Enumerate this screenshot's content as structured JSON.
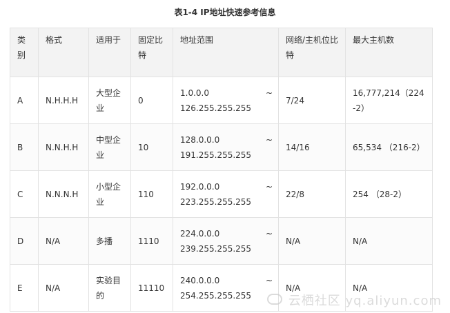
{
  "title": "表1-4 IP地址快速参考信息",
  "table": {
    "headers": [
      "类别",
      "格式",
      "适用于",
      "固定比特",
      "地址范围",
      "网络/主机位比特",
      "最大主机数"
    ],
    "rows": [
      {
        "class": "A",
        "format": "N.H.H.H",
        "use": "大型企业",
        "fixed_bits": "0",
        "range_start": "1.0.0.0",
        "tilde": "~",
        "range_end": "126.255.255.255",
        "bits": "7/24",
        "max_hosts": "16,777,214（224-2）"
      },
      {
        "class": "B",
        "format": "N.N.H.H",
        "use": "中型企业",
        "fixed_bits": "10",
        "range_start": "128.0.0.0",
        "tilde": "~",
        "range_end": "191.255.255.255",
        "bits": "14/16",
        "max_hosts": "65,534 （216-2）"
      },
      {
        "class": "C",
        "format": "N.N.N.H",
        "use": "小型企业",
        "fixed_bits": "110",
        "range_start": "192.0.0.0",
        "tilde": "~",
        "range_end": "223.255.255.255",
        "bits": "22/8",
        "max_hosts": "254 （28-2）"
      },
      {
        "class": "D",
        "format": "N/A",
        "use": "多播",
        "fixed_bits": "1110",
        "range_start": "224.0.0.0",
        "tilde": "~",
        "range_end": "239.255.255.255",
        "bits": "N/A",
        "max_hosts": "N/A"
      },
      {
        "class": "E",
        "format": "N/A",
        "use": "实验目的",
        "fixed_bits": "11110",
        "range_start": "240.0.0.0",
        "tilde": "~",
        "range_end": "254.255.255.255",
        "bits": "N/A",
        "max_hosts": "N/A"
      }
    ]
  },
  "watermark": {
    "text": "云栖社区 yq.aliyun.com",
    "icon": "cloud-icon"
  }
}
